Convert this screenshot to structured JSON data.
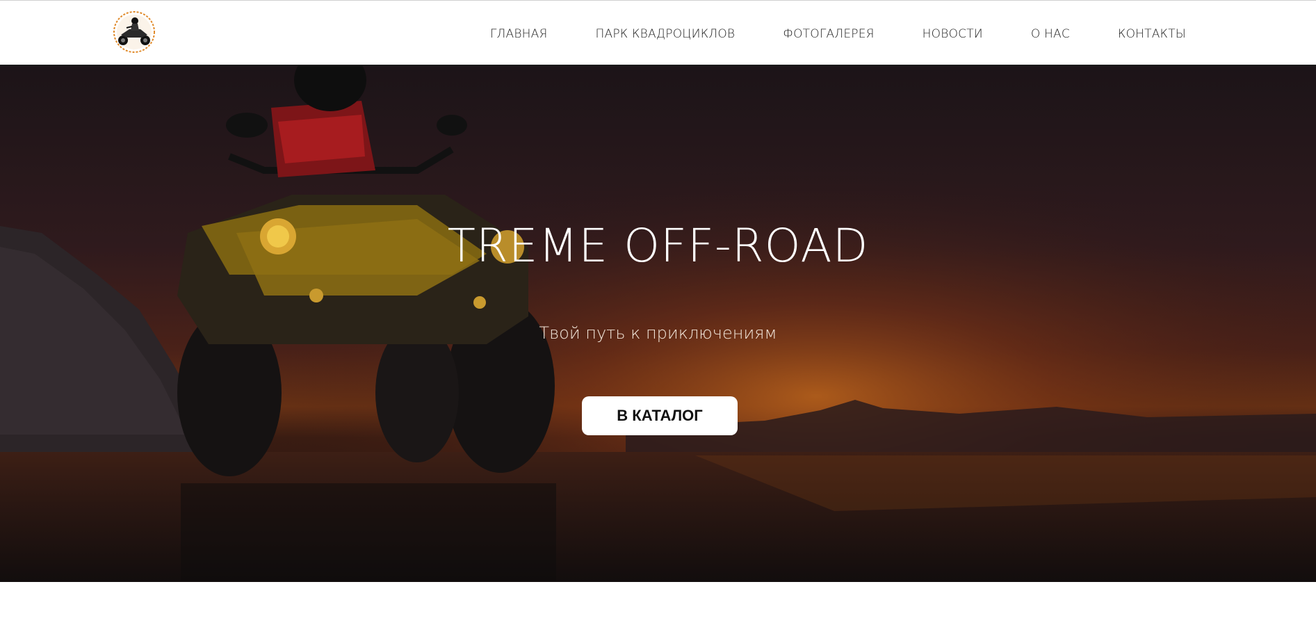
{
  "header": {
    "logo_icon": "atv-rider-logo-icon",
    "nav": [
      {
        "label": "ГЛАВНАЯ"
      },
      {
        "label": "ПАРК КВАДРОЦИКЛОВ"
      },
      {
        "label": "ФОТОГАЛЕРЕЯ"
      },
      {
        "label": "НОВОСТИ"
      },
      {
        "label": "О НАС"
      },
      {
        "label": "КОНТАКТЫ"
      }
    ]
  },
  "hero": {
    "title": "TREME OFF-ROAD",
    "subtitle": "Твой путь к приключениям",
    "cta_label": "В КАТАЛОГ",
    "background_image": "atv-sunset-lake-image"
  },
  "colors": {
    "header_bg": "#ffffff",
    "hero_overlay": "#1a1214",
    "sunset_orange": "#c8501e",
    "atv_yellow": "#c9a017",
    "cta_bg": "#ffffff"
  }
}
